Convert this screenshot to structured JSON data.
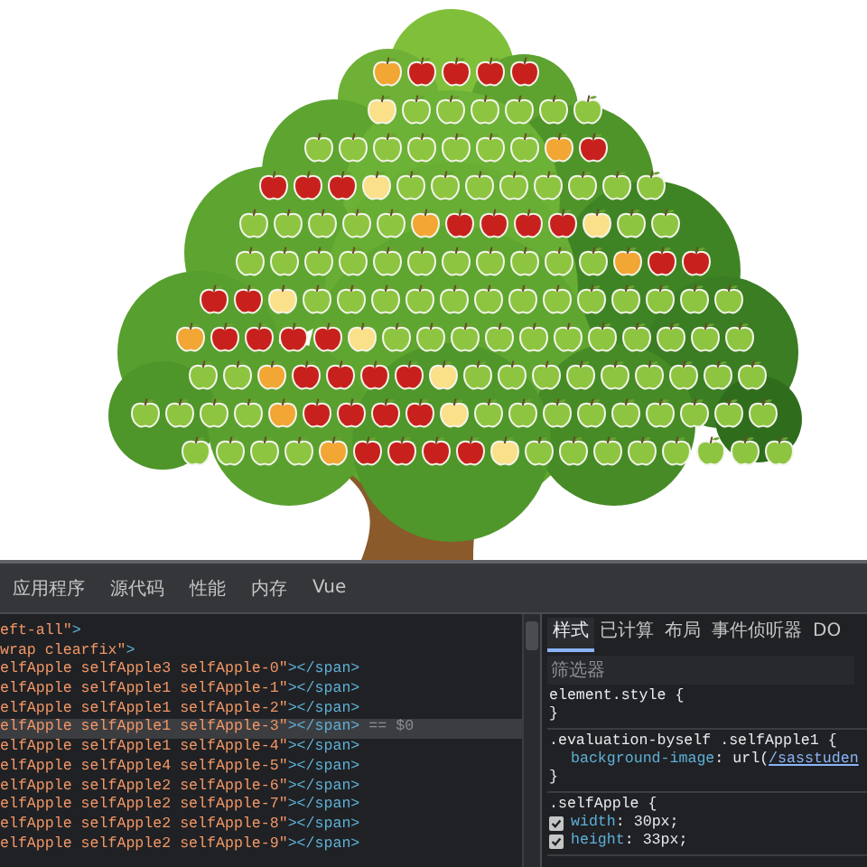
{
  "tree": {
    "rows": [
      {
        "apples": [
          {
            "color": "#f2a634"
          },
          {
            "color": "#c8211d"
          },
          {
            "color": "#c8211d"
          },
          {
            "color": "#c8211d"
          },
          {
            "color": "#c8211d"
          }
        ]
      },
      {
        "apples": [
          {
            "color": "#fbe08a"
          },
          {
            "color": "#8dc540"
          },
          {
            "color": "#8dc540"
          },
          {
            "color": "#8dc540"
          },
          {
            "color": "#8dc540"
          },
          {
            "color": "#8dc540"
          },
          {
            "color": "#8dc540"
          }
        ]
      },
      {
        "apples": [
          {
            "color": "#8dc540"
          },
          {
            "color": "#8dc540"
          },
          {
            "color": "#8dc540"
          },
          {
            "color": "#8dc540"
          },
          {
            "color": "#8dc540"
          },
          {
            "color": "#8dc540"
          },
          {
            "color": "#8dc540"
          },
          {
            "color": "#f2a634"
          },
          {
            "color": "#c8211d"
          }
        ]
      },
      {
        "apples": [
          {
            "color": "#c8211d"
          },
          {
            "color": "#c8211d"
          },
          {
            "color": "#c8211d"
          },
          {
            "color": "#fbe08a"
          },
          {
            "color": "#8dc540"
          },
          {
            "color": "#8dc540"
          },
          {
            "color": "#8dc540"
          },
          {
            "color": "#8dc540"
          },
          {
            "color": "#8dc540"
          },
          {
            "color": "#8dc540"
          },
          {
            "color": "#8dc540"
          },
          {
            "color": "#8dc540"
          }
        ]
      },
      {
        "apples": [
          {
            "color": "#8dc540"
          },
          {
            "color": "#8dc540"
          },
          {
            "color": "#8dc540"
          },
          {
            "color": "#8dc540"
          },
          {
            "color": "#8dc540"
          },
          {
            "color": "#f2a634"
          },
          {
            "color": "#c8211d"
          },
          {
            "color": "#c8211d"
          },
          {
            "color": "#c8211d"
          },
          {
            "color": "#c8211d"
          },
          {
            "color": "#fbe08a"
          },
          {
            "color": "#8dc540"
          },
          {
            "color": "#8dc540"
          }
        ]
      },
      {
        "apples": [
          {
            "color": "#8dc540"
          },
          {
            "color": "#8dc540"
          },
          {
            "color": "#8dc540"
          },
          {
            "color": "#8dc540"
          },
          {
            "color": "#8dc540"
          },
          {
            "color": "#8dc540"
          },
          {
            "color": "#8dc540"
          },
          {
            "color": "#8dc540"
          },
          {
            "color": "#8dc540"
          },
          {
            "color": "#8dc540"
          },
          {
            "color": "#8dc540"
          },
          {
            "color": "#f2a634"
          },
          {
            "color": "#c8211d"
          },
          {
            "color": "#c8211d"
          }
        ]
      },
      {
        "apples": [
          {
            "color": "#c8211d"
          },
          {
            "color": "#c8211d"
          },
          {
            "color": "#fbe08a"
          },
          {
            "color": "#8dc540"
          },
          {
            "color": "#8dc540"
          },
          {
            "color": "#8dc540"
          },
          {
            "color": "#8dc540"
          },
          {
            "color": "#8dc540"
          },
          {
            "color": "#8dc540"
          },
          {
            "color": "#8dc540"
          },
          {
            "color": "#8dc540"
          },
          {
            "color": "#8dc540"
          },
          {
            "color": "#8dc540"
          },
          {
            "color": "#8dc540"
          },
          {
            "color": "#8dc540"
          },
          {
            "color": "#8dc540"
          }
        ]
      },
      {
        "apples": [
          {
            "color": "#f2a634"
          },
          {
            "color": "#c8211d"
          },
          {
            "color": "#c8211d"
          },
          {
            "color": "#c8211d"
          },
          {
            "color": "#c8211d"
          },
          {
            "color": "#fbe08a"
          },
          {
            "color": "#8dc540"
          },
          {
            "color": "#8dc540"
          },
          {
            "color": "#8dc540"
          },
          {
            "color": "#8dc540"
          },
          {
            "color": "#8dc540"
          },
          {
            "color": "#8dc540"
          },
          {
            "color": "#8dc540"
          },
          {
            "color": "#8dc540"
          },
          {
            "color": "#8dc540"
          },
          {
            "color": "#8dc540"
          },
          {
            "color": "#8dc540"
          }
        ]
      },
      {
        "apples": [
          {
            "color": "#8dc540"
          },
          {
            "color": "#8dc540"
          },
          {
            "color": "#f2a634"
          },
          {
            "color": "#c8211d"
          },
          {
            "color": "#c8211d"
          },
          {
            "color": "#c8211d"
          },
          {
            "color": "#c8211d"
          },
          {
            "color": "#fbe08a"
          },
          {
            "color": "#8dc540"
          },
          {
            "color": "#8dc540"
          },
          {
            "color": "#8dc540"
          },
          {
            "color": "#8dc540"
          },
          {
            "color": "#8dc540"
          },
          {
            "color": "#8dc540"
          },
          {
            "color": "#8dc540"
          },
          {
            "color": "#8dc540"
          },
          {
            "color": "#8dc540"
          }
        ]
      },
      {
        "apples": [
          {
            "color": "#8dc540"
          },
          {
            "color": "#8dc540"
          },
          {
            "color": "#8dc540"
          },
          {
            "color": "#8dc540"
          },
          {
            "color": "#f2a634"
          },
          {
            "color": "#c8211d"
          },
          {
            "color": "#c8211d"
          },
          {
            "color": "#c8211d"
          },
          {
            "color": "#c8211d"
          },
          {
            "color": "#fbe08a"
          },
          {
            "color": "#8dc540"
          },
          {
            "color": "#8dc540"
          },
          {
            "color": "#8dc540"
          },
          {
            "color": "#8dc540"
          },
          {
            "color": "#8dc540"
          },
          {
            "color": "#8dc540"
          },
          {
            "color": "#8dc540"
          },
          {
            "color": "#8dc540"
          },
          {
            "color": "#8dc540"
          }
        ]
      },
      {
        "apples": [
          {
            "color": "#8dc540"
          },
          {
            "color": "#8dc540"
          },
          {
            "color": "#8dc540"
          },
          {
            "color": "#8dc540"
          },
          {
            "color": "#f2a634"
          },
          {
            "color": "#c8211d"
          },
          {
            "color": "#c8211d"
          },
          {
            "color": "#c8211d"
          },
          {
            "color": "#c8211d"
          },
          {
            "color": "#fbe08a"
          },
          {
            "color": "#8dc540"
          },
          {
            "color": "#8dc540"
          },
          {
            "color": "#8dc540"
          },
          {
            "color": "#8dc540"
          },
          {
            "color": "#8dc540"
          },
          {
            "color": "#8dc540"
          },
          {
            "color": "#8dc540"
          },
          {
            "color": "#8dc540"
          }
        ]
      }
    ]
  },
  "devtools": {
    "tabs": [
      {
        "label": "应用程序",
        "selected": false
      },
      {
        "label": "源代码",
        "selected": false
      },
      {
        "label": "性能",
        "selected": false
      },
      {
        "label": "内存",
        "selected": false
      },
      {
        "label": "Vue",
        "selected": false
      }
    ],
    "elements": [
      {
        "value": "eft-all\"",
        "tag": ">",
        "selected": false
      },
      {
        "value": "wrap clearfix\"",
        "tag": ">",
        "selected": false
      },
      {
        "value": "elfApple selfApple3 selfApple-0\"",
        "tag": "></span>",
        "selected": false
      },
      {
        "value": "elfApple selfApple1 selfApple-1\"",
        "tag": "></span>",
        "selected": false
      },
      {
        "value": "elfApple selfApple1 selfApple-2\"",
        "tag": "></span>",
        "selected": false
      },
      {
        "value": "elfApple selfApple1 selfApple-3\"",
        "tag": "></span>",
        "selected": true,
        "suffix": "== $0"
      },
      {
        "value": "elfApple selfApple1 selfApple-4\"",
        "tag": "></span>",
        "selected": false
      },
      {
        "value": "elfApple selfApple4 selfApple-5\"",
        "tag": "></span>",
        "selected": false
      },
      {
        "value": "elfApple selfApple2 selfApple-6\"",
        "tag": "></span>",
        "selected": false
      },
      {
        "value": "elfApple selfApple2 selfApple-7\"",
        "tag": "></span>",
        "selected": false
      },
      {
        "value": "elfApple selfApple2 selfApple-8\"",
        "tag": "></span>",
        "selected": false
      },
      {
        "value": "elfApple selfApple2 selfApple-9\"",
        "tag": "></span>",
        "selected": false
      }
    ],
    "styles_tabs": [
      {
        "label": "样式",
        "selected": true
      },
      {
        "label": "已计算",
        "selected": false
      },
      {
        "label": "布局",
        "selected": false
      },
      {
        "label": "事件侦听器",
        "selected": false
      },
      {
        "label": "DO",
        "selected": false
      }
    ],
    "filter": {
      "placeholder": "筛选器"
    },
    "rules": [
      {
        "selector": "element.style {",
        "close": "}"
      },
      {
        "selector": ".evaluation-byself .selfApple1 {",
        "close": "}",
        "declarations": [
          {
            "kind": "plain",
            "property": "background-image",
            "value": ": url(",
            "link": "/sasstuden"
          }
        ]
      },
      {
        "selector": ".selfApple {",
        "declarations": [
          {
            "kind": "checkbox",
            "checked": true,
            "property": "width",
            "value": ": 30px;"
          },
          {
            "kind": "checkbox",
            "checked": true,
            "property": "height",
            "value": ": 33px;"
          }
        ]
      }
    ]
  }
}
